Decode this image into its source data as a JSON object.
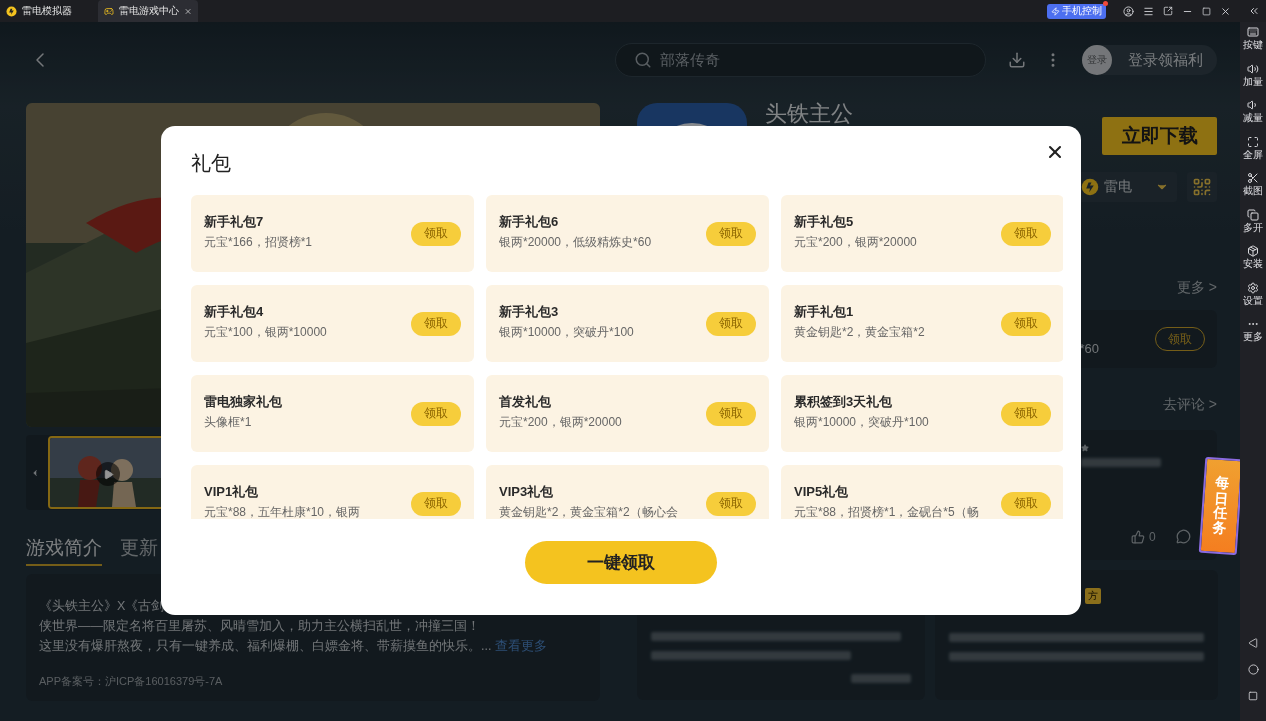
{
  "titlebar": {
    "tabs": [
      {
        "label": "雷电模拟器",
        "selected": false,
        "closable": false
      },
      {
        "label": "雷电游戏中心",
        "selected": true,
        "closable": true
      }
    ],
    "phone_control": "手机控制"
  },
  "sidebar": {
    "items": [
      {
        "label": "按键",
        "kind": "keys"
      },
      {
        "label": "加量",
        "kind": "volup"
      },
      {
        "label": "减量",
        "kind": "voldown"
      },
      {
        "label": "全屏",
        "kind": "fullscreen"
      },
      {
        "label": "截图",
        "kind": "screenshot"
      },
      {
        "label": "多开",
        "kind": "multi"
      },
      {
        "label": "安装",
        "kind": "install"
      },
      {
        "label": "设置",
        "kind": "settings"
      },
      {
        "label": "更多",
        "kind": "more"
      }
    ]
  },
  "header": {
    "search_placeholder": "部落传奇",
    "avatar": "登录",
    "login": "登录领福利"
  },
  "game": {
    "title": "头铁主公",
    "download": "立即下载",
    "channel": "雷电"
  },
  "media": {
    "thumbnails": [
      {
        "selected": true
      }
    ]
  },
  "intro": {
    "tabs": [
      {
        "label": "游戏简介",
        "selected": true
      },
      {
        "label": "更新",
        "selected": false
      }
    ],
    "lines": [
      "《头铁主公》X《古剑",
      "侠世界——限定名将百里屠苏、风晴雪加入，助力主公横扫乱世，冲撞三国！",
      "这里没有爆肝熬夜，只有一键养成、福利爆棚、白嫖金将、带薪摸鱼的快乐。..."
    ],
    "more_link": "查看更多",
    "record": "APP备案号：沪ICP备16016379号-7A"
  },
  "gift_section": {
    "more": "更多 >",
    "reward": "*60",
    "claim": "领取"
  },
  "reviews": {
    "link": "去评论 >",
    "likes": "0",
    "tag": "方"
  },
  "daily_task": "每日任务",
  "modal": {
    "title": "礼包",
    "claim_all": "一键领取",
    "gifts": [
      {
        "name": "新手礼包7",
        "desc": "元宝*166，招贤榜*1",
        "action": "领取"
      },
      {
        "name": "新手礼包6",
        "desc": "银两*20000，低级精炼史*60",
        "action": "领取"
      },
      {
        "name": "新手礼包5",
        "desc": "元宝*200，银两*20000",
        "action": "领取"
      },
      {
        "name": "新手礼包4",
        "desc": "元宝*100，银两*10000",
        "action": "领取"
      },
      {
        "name": "新手礼包3",
        "desc": "银两*10000，突破丹*100",
        "action": "领取"
      },
      {
        "name": "新手礼包1",
        "desc": "黄金钥匙*2，黄金宝箱*2",
        "action": "领取"
      },
      {
        "name": "雷电独家礼包",
        "desc": "头像框*1",
        "action": "领取"
      },
      {
        "name": "首发礼包",
        "desc": "元宝*200，银两*20000",
        "action": "领取"
      },
      {
        "name": "累积签到3天礼包",
        "desc": "银两*10000，突破丹*100",
        "action": "领取"
      },
      {
        "name": "VIP1礼包",
        "desc": "元宝*88，五年杜康*10，银两",
        "action": "领取"
      },
      {
        "name": "VIP3礼包",
        "desc": "黄金钥匙*2，黄金宝箱*2（畅心会",
        "action": "领取"
      },
      {
        "name": "VIP5礼包",
        "desc": "元宝*88，招贤榜*1，金砚台*5（畅",
        "action": "领取"
      }
    ]
  }
}
